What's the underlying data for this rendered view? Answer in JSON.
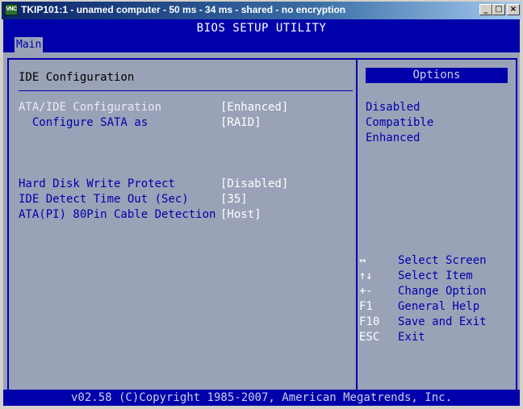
{
  "window": {
    "icon_label": "VNC",
    "title": "TKIP101:1 - unamed computer - 50 ms - 34 ms - shared - no encryption",
    "buttons": {
      "minimize": "_",
      "maximize": "□",
      "close": "×"
    }
  },
  "bios": {
    "title": "BIOS SETUP UTILITY",
    "tab": "Main",
    "section_title": "IDE Configuration",
    "settings": [
      {
        "label": "ATA/IDE Configuration",
        "value": "[Enhanced]"
      },
      {
        "label": "  Configure SATA as",
        "value": "[RAID]"
      },
      {
        "label": "Hard Disk Write Protect",
        "value": "[Disabled]"
      },
      {
        "label": "IDE Detect Time Out (Sec)",
        "value": "[35]"
      },
      {
        "label": "ATA(PI) 80Pin Cable Detection",
        "value": "[Host]"
      }
    ],
    "options_header": "Options",
    "options": [
      "Disabled",
      "Compatible",
      "Enhanced"
    ],
    "help": [
      {
        "key": "↔",
        "text": "Select Screen"
      },
      {
        "key": "↑↓",
        "text": "Select Item"
      },
      {
        "key": "+-",
        "text": "Change Option"
      },
      {
        "key": "F1",
        "text": "General Help"
      },
      {
        "key": "F10",
        "text": "Save and Exit"
      },
      {
        "key": "ESC",
        "text": "Exit"
      }
    ],
    "footer": "v02.58 (C)Copyright 1985-2007, American Megatrends, Inc."
  },
  "colors": {
    "bios_blue": "#0000aa",
    "bios_gray": "#9aa2b8",
    "selected_text": "#e9ecf4",
    "value_text": "#ffffff"
  }
}
